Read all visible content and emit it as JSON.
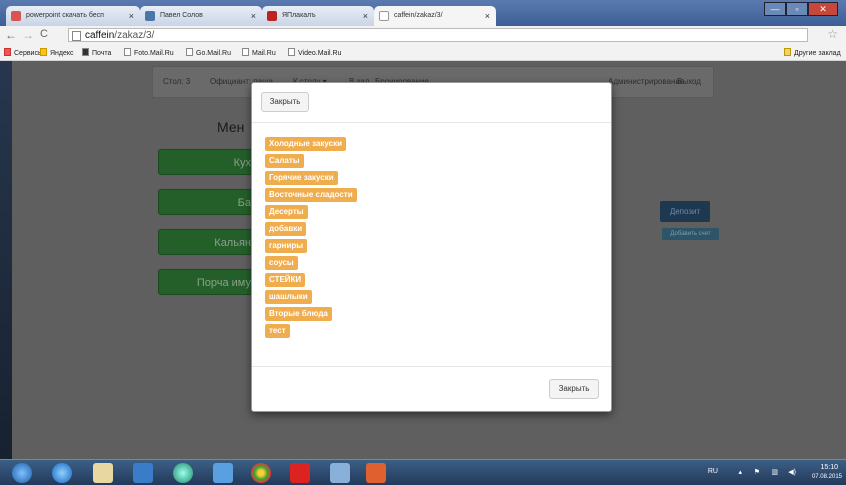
{
  "browser": {
    "tabs": [
      {
        "label": "powerpoint скачать бесп",
        "active": false
      },
      {
        "label": "Павел Солов",
        "active": false
      },
      {
        "label": "ЯПлакалъ",
        "active": false
      },
      {
        "label": "caffein/zakaz/3/",
        "active": true
      }
    ],
    "tab_close": "×",
    "window_buttons": {
      "minimize": "—",
      "maximize": "▫",
      "close": "✕"
    },
    "back": "←",
    "forward": "→",
    "reload": "C",
    "url_host": "caffein",
    "url_path": "/zakaz/3/",
    "star": "☆",
    "bookmarks": [
      "Сервисы",
      "Яндекс",
      "Почта",
      "Foto.Mail.Ru",
      "Go.Mail.Ru",
      "Mail.Ru",
      "Video.Mail.Ru"
    ],
    "other_bookmarks": "Другие заклад"
  },
  "nav": {
    "table": "Стол: 3",
    "waiter": "Официант: паша",
    "to_table": "К столу ▾",
    "to_hall": "В зал",
    "booking": "Бронирование",
    "admin": "Администрирование",
    "logout": "Выход"
  },
  "menu": {
    "title": "Мен",
    "buttons": [
      "Кух",
      "Ба",
      "Кальян",
      "Порча иму"
    ]
  },
  "side": {
    "deposit": "Депозит",
    "add_account": "Добавить счет"
  },
  "modal": {
    "close_top": "Закрыть",
    "close_bottom": "Закрыть",
    "categories": [
      "Холодные закуски",
      "Салаты",
      "Горячие закуски",
      "Восточные сладости",
      "Десерты",
      "добавки",
      "гарниры",
      "соусы",
      "СТЕЙКИ",
      "шашлыки",
      "Вторые блюда",
      "тест"
    ]
  },
  "taskbar": {
    "lang": "RU",
    "time": "15:10",
    "date": "07.08.2015"
  },
  "colors": {
    "category_badge": "#f0ad4e",
    "green_button": "#245f2a",
    "deposit_button": "#1e3850"
  }
}
